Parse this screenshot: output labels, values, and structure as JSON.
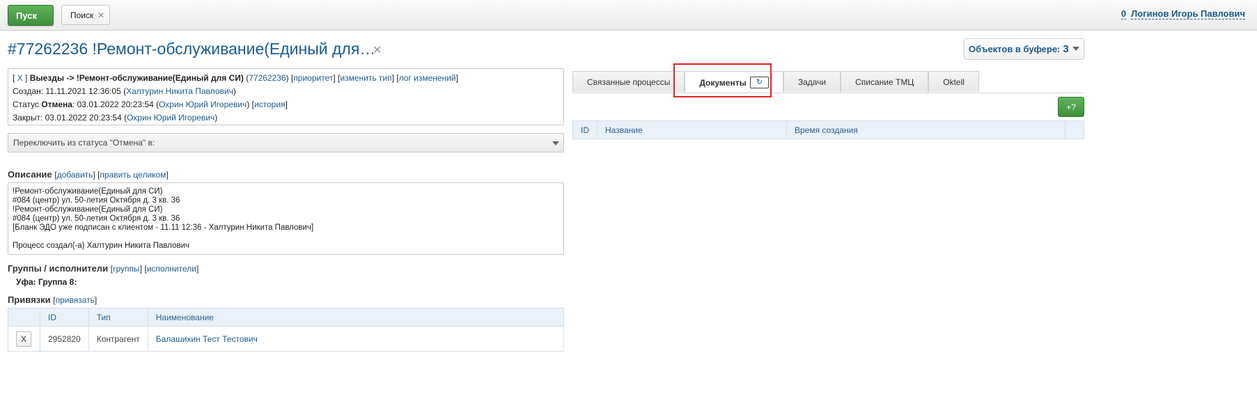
{
  "topbar": {
    "start_label": "Пуск",
    "search_label": "Поиск",
    "search_close": "✕",
    "counter": "0",
    "user_name": "Логинов Игорь Павлович"
  },
  "header": {
    "title": "#77262236 !Ремонт-обслуживание(Единый для…",
    "close": "✕",
    "buffer_label": "Объектов в буфере:",
    "buffer_count": "3"
  },
  "info": {
    "line1": {
      "close_open": "[ ",
      "close_x": "X",
      "close_end": " ] ",
      "path": "Выезды -> !Ремонт-обслуживание(Единый для СИ)",
      "id_open": " (",
      "id_link": "77262236",
      "id_close": ") ",
      "priority": "приоритет",
      "change_type": "изменить тип",
      "log": "лог изменений"
    },
    "line2": {
      "label": "Создан: 11.11.2021 12:36:05 (",
      "user": "Халтурин Никита Павлович",
      "end": ")"
    },
    "line3": {
      "label": "Статус ",
      "status": "Отмена",
      "date": ": 03.01.2022 20:23:54 (",
      "user": "Охрин Юрий Игоревич",
      "mid": ") ",
      "history": "история"
    },
    "line4": {
      "label": "Закрыт: 03.01.2022 20:23:54 (",
      "user": "Охрин Юрий Игоревич",
      "end": ")"
    }
  },
  "status_switch": "Переключить из статуса \"Отмена\" в:",
  "description": {
    "title": "Описание",
    "add": "добавить",
    "edit_all": "править целиком",
    "text": "!Ремонт-обслуживание(Единый для СИ)\n#084 (центр) ул. 50-летия Октября д. 3 кв. 36\n!Ремонт-обслуживание(Единый для СИ)\n#084 (центр) ул. 50-летия Октября д. 3 кв. 36\n[Бланк ЭДО уже подписан с клиентом - 11.11 12:36 - Халтурин Никита Павлович]\n\nПроцесс создал(-а) Халтурин Никита Павлович"
  },
  "groups": {
    "title": "Группы / исполнители",
    "groups_link": "группы",
    "executors_link": "исполнители",
    "group_line": "Уфа: Группа 8:"
  },
  "links": {
    "title": "Привязки",
    "bind": "привязать",
    "columns": [
      "",
      "ID",
      "Тип",
      "Наименование"
    ],
    "rows": [
      {
        "x": "X",
        "id": "2952820",
        "type": "Контрагент",
        "name": "Балашихин Тест Тестович"
      }
    ]
  },
  "tabs": {
    "items": [
      "Связанные процессы",
      "Документы",
      "Задачи",
      "Списание ТМЦ",
      "Oktell"
    ],
    "active": "Документы",
    "refresh_icon": "↻"
  },
  "docs": {
    "plus": "+?",
    "columns": [
      "ID",
      "Название",
      "Время создания",
      ""
    ]
  },
  "colors": {
    "link": "#1f5a8c",
    "accent_green": "#4aa046",
    "highlight": "#e0202a"
  }
}
